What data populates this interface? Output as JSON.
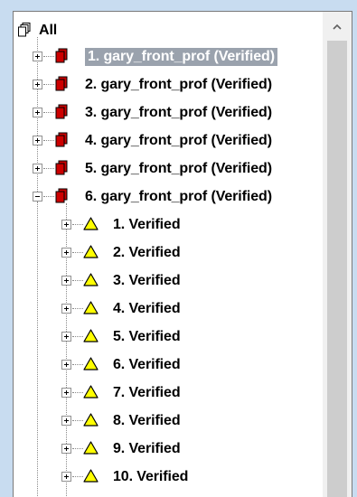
{
  "tree": {
    "root": {
      "label": "All",
      "icon": "stack-pages-icon"
    },
    "level1": [
      {
        "label": "1. gary_front_prof (Verified)",
        "selected": true,
        "expanded": false
      },
      {
        "label": "2. gary_front_prof (Verified)",
        "selected": false,
        "expanded": false
      },
      {
        "label": "3. gary_front_prof (Verified)",
        "selected": false,
        "expanded": false
      },
      {
        "label": "4. gary_front_prof (Verified)",
        "selected": false,
        "expanded": false
      },
      {
        "label": "5. gary_front_prof (Verified)",
        "selected": false,
        "expanded": false
      },
      {
        "label": "6. gary_front_prof (Verified)",
        "selected": false,
        "expanded": true
      }
    ],
    "level2": [
      {
        "label": "1. Verified"
      },
      {
        "label": "2. Verified"
      },
      {
        "label": "3. Verified"
      },
      {
        "label": "4. Verified"
      },
      {
        "label": "5. Verified"
      },
      {
        "label": "6. Verified"
      },
      {
        "label": "7. Verified"
      },
      {
        "label": "8. Verified"
      },
      {
        "label": "9. Verified"
      },
      {
        "label": "10. Verified"
      }
    ]
  },
  "colors": {
    "background": "#c8dcf0",
    "selection": "#9aa2ad",
    "item_icon_red": "#cc0000",
    "warning_icon_yellow": "#ffff00"
  }
}
